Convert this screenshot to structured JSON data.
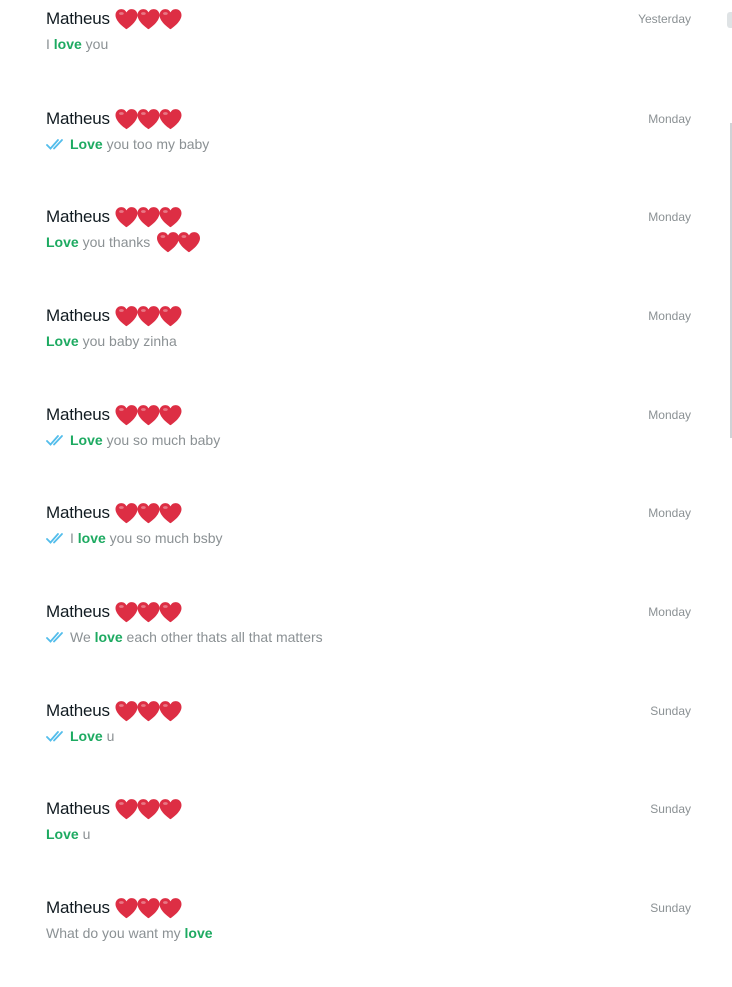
{
  "colors": {
    "highlight": "#1daa61",
    "read_ticks": "#53bdeb",
    "heart": "#dd2e44"
  },
  "icons": {
    "read_receipt": "double-check-icon",
    "heart": "red-heart-emoji"
  },
  "results": [
    {
      "name": "Matheus",
      "time": "Yesterday",
      "ticks": false,
      "before": "I ",
      "match": "love",
      "after": " you",
      "trailing_hearts": 0
    },
    {
      "name": "Matheus",
      "time": "Monday",
      "ticks": true,
      "before": "",
      "match": "Love",
      "after": " you too my baby",
      "trailing_hearts": 0
    },
    {
      "name": "Matheus",
      "time": "Monday",
      "ticks": false,
      "before": "",
      "match": "Love",
      "after": " you thanks ",
      "trailing_hearts": 2
    },
    {
      "name": "Matheus",
      "time": "Monday",
      "ticks": false,
      "before": "",
      "match": "Love",
      "after": " you baby zinha",
      "trailing_hearts": 0
    },
    {
      "name": "Matheus",
      "time": "Monday",
      "ticks": true,
      "before": "",
      "match": "Love",
      "after": " you so much baby",
      "trailing_hearts": 0
    },
    {
      "name": "Matheus",
      "time": "Monday",
      "ticks": true,
      "before": "I ",
      "match": "love",
      "after": " you so much bsby",
      "trailing_hearts": 0
    },
    {
      "name": "Matheus",
      "time": "Monday",
      "ticks": true,
      "before": "We ",
      "match": "love",
      "after": " each other thats all that matters",
      "trailing_hearts": 0
    },
    {
      "name": "Matheus",
      "time": "Sunday",
      "ticks": true,
      "before": "",
      "match": "Love",
      "after": " u",
      "trailing_hearts": 0
    },
    {
      "name": "Matheus",
      "time": "Sunday",
      "ticks": false,
      "before": "",
      "match": "Love",
      "after": " u",
      "trailing_hearts": 0
    },
    {
      "name": "Matheus",
      "time": "Sunday",
      "ticks": false,
      "before": "What do you want my ",
      "match": "love",
      "after": "",
      "trailing_hearts": 0
    }
  ]
}
